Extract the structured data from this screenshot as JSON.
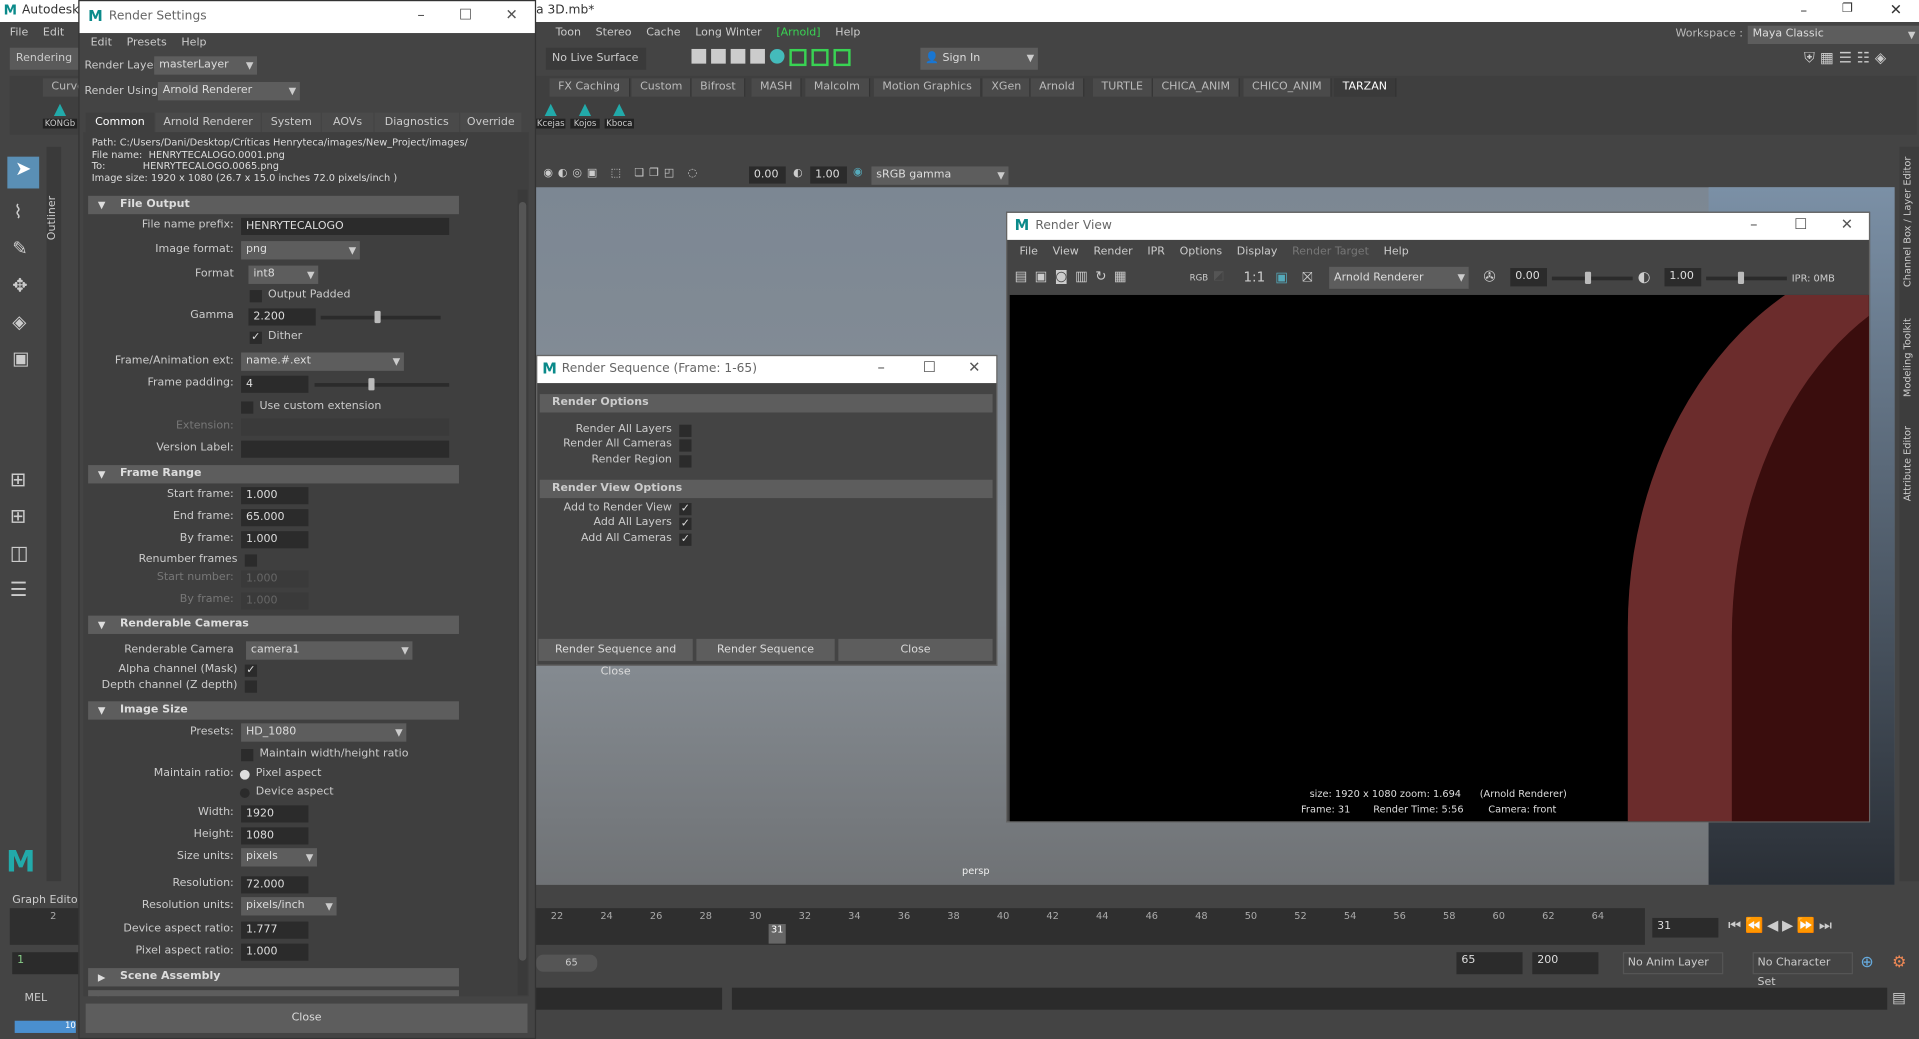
{
  "maya": {
    "title": "Autodesk",
    "title_suffix": "a 3D.mb*",
    "menu": [
      "File",
      "Edit"
    ],
    "menu_right": [
      "Toon",
      "Stereo",
      "Cache",
      "Long Winter",
      "[Arnold]",
      "Help"
    ],
    "arnold_color": "#39d353",
    "mode": "Rendering",
    "live_surface": "No Live Surface",
    "sign_in": "Sign In",
    "workspace_label": "Workspace :",
    "workspace": "Maya Classic",
    "shelf_tabs": [
      "Curve",
      "FX Caching",
      "Custom",
      "Bifrost",
      "MASH",
      "Malcolm",
      "Motion Graphics",
      "XGen",
      "Arnold",
      "TURTLE",
      "CHICA_ANIM",
      "CHICO_ANIM",
      "TARZAN"
    ],
    "shelf_icons": [
      "KONGb",
      "Kcejas",
      "Kojos",
      "Kboca"
    ],
    "viewport": {
      "exposure": "0.00",
      "gamma": "1.00",
      "color_space": "sRGB gamma",
      "camera": "persp"
    },
    "outliner": "Outliner",
    "right_tabs": [
      "Channel Box / Layer Editor",
      "Modeling Toolkit",
      "Attribute Editor"
    ],
    "graph_editor": "Graph Editor",
    "timeline": {
      "ticks": [
        "2",
        "22",
        "24",
        "26",
        "28",
        "30",
        "32",
        "34",
        "36",
        "38",
        "40",
        "42",
        "44",
        "46",
        "48",
        "50",
        "52",
        "54",
        "56",
        "58",
        "60",
        "62",
        "64"
      ],
      "current": "31",
      "current_field": "31"
    },
    "range": {
      "start": "1",
      "range_end": "65",
      "end": "65",
      "anim_end": "200",
      "anim_layer": "No Anim Layer",
      "char_set": "No Character Set"
    },
    "cmd": {
      "lang": "MEL"
    },
    "progress": "10"
  },
  "render_settings": {
    "title": "Render Settings",
    "menu": [
      "Edit",
      "Presets",
      "Help"
    ],
    "render_layer_label": "Render Layer",
    "render_layer": "masterLayer",
    "render_using_label": "Render Using",
    "render_using": "Arnold Renderer",
    "tabs": [
      "Common",
      "Arnold Renderer",
      "System",
      "AOVs",
      "Diagnostics",
      "Override"
    ],
    "info": [
      "Path: C:/Users/Dani/Desktop/Críticas Henryteca/images/New_Project/images/",
      "File name:  HENRYTECALOGO.0001.png",
      "To:            HENRYTECALOGO.0065.png",
      "Image size: 1920 x 1080 (26.7 x 15.0 inches 72.0 pixels/inch )"
    ],
    "sections": [
      "File Output",
      "Frame Range",
      "Renderable Cameras",
      "Image Size",
      "Scene Assembly"
    ],
    "rows": [
      {
        "t": "field",
        "label": "File name prefix:",
        "value": "HENRYTECALOGO"
      },
      {
        "t": "dd",
        "label": "Image format:",
        "value": "png"
      },
      {
        "t": "dd",
        "label": "Format",
        "value": "int8"
      },
      {
        "t": "cb",
        "text": "Output Padded",
        "checked": false
      },
      {
        "t": "slider",
        "label": "Gamma",
        "value": "2.200",
        "level": 0.45
      },
      {
        "t": "cb",
        "text": "Dither",
        "checked": true
      },
      {
        "t": "dd",
        "label": "Frame/Animation ext:",
        "value": "name.#.ext"
      },
      {
        "t": "slider",
        "label": "Frame padding:",
        "value": "4",
        "level": 0.4
      },
      {
        "t": "cb",
        "text": "Use custom extension",
        "checked": false
      },
      {
        "t": "field",
        "label": "Extension:",
        "value": "",
        "disabled": true
      },
      {
        "t": "field",
        "label": "Version Label:",
        "value": ""
      },
      {
        "t": "field",
        "label": "Start frame:",
        "value": "1.000"
      },
      {
        "t": "field",
        "label": "End frame:",
        "value": "65.000"
      },
      {
        "t": "field",
        "label": "By frame:",
        "value": "1.000"
      },
      {
        "t": "cbl",
        "label": "Renumber frames",
        "checked": false
      },
      {
        "t": "field",
        "label": "Start number:",
        "value": "1.000",
        "disabled": true
      },
      {
        "t": "field",
        "label": "By frame:",
        "value": "1.000",
        "disabled": true
      },
      {
        "t": "dd",
        "label": "Renderable Camera",
        "value": "camera1"
      },
      {
        "t": "cbl",
        "label": "Alpha channel (Mask)",
        "checked": true
      },
      {
        "t": "cbl",
        "label": "Depth channel (Z depth)",
        "checked": false
      },
      {
        "t": "dd",
        "label": "Presets:",
        "value": "HD_1080"
      },
      {
        "t": "cb",
        "text": "Maintain width/height ratio",
        "checked": false
      },
      {
        "t": "radio",
        "label": "Maintain ratio:",
        "text": "Pixel aspect",
        "checked": true
      },
      {
        "t": "radio",
        "label": "",
        "text": "Device aspect",
        "checked": false
      },
      {
        "t": "field",
        "label": "Width:",
        "value": "1920"
      },
      {
        "t": "field",
        "label": "Height:",
        "value": "1080"
      },
      {
        "t": "dd",
        "label": "Size units:",
        "value": "pixels"
      },
      {
        "t": "field",
        "label": "Resolution:",
        "value": "72.000"
      },
      {
        "t": "dd",
        "label": "Resolution units:",
        "value": "pixels/inch"
      },
      {
        "t": "field",
        "label": "Device aspect ratio:",
        "value": "1.777"
      },
      {
        "t": "field",
        "label": "Pixel aspect ratio:",
        "value": "1.000"
      }
    ],
    "close": "Close"
  },
  "render_sequence": {
    "title": "Render Sequence (Frame: 1-65)",
    "render_options": "Render Options",
    "opts": [
      {
        "label": "Render All Layers",
        "checked": false
      },
      {
        "label": "Render All Cameras",
        "checked": false
      },
      {
        "label": "Render Region",
        "checked": false
      }
    ],
    "view_options": "Render View Options",
    "view_opts": [
      {
        "label": "Add to Render View",
        "checked": true
      },
      {
        "label": "Add All Layers",
        "checked": true
      },
      {
        "label": "Add All Cameras",
        "checked": true
      }
    ],
    "buttons": [
      "Render Sequence and Close",
      "Render Sequence",
      "Close"
    ]
  },
  "render_view": {
    "title": "Render View",
    "menu": [
      "File",
      "View",
      "Render",
      "IPR",
      "Options",
      "Display",
      "Render Target",
      "Help"
    ],
    "rgb": "RGB",
    "ratio": "1:1",
    "renderer": "Arnold Renderer",
    "exposure": "0.00",
    "gamma": "1.00",
    "ipr": "IPR: 0MB",
    "info1": "size: 1920 x 1080 zoom: 1.694",
    "info1b": "(Arnold Renderer)",
    "frame": "Frame: 31",
    "time": "Render Time:  5:56",
    "camera": "Camera: front"
  }
}
